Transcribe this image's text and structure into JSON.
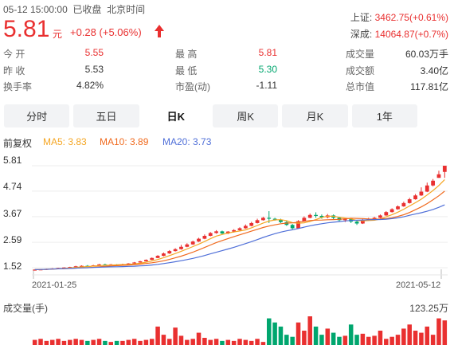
{
  "status": {
    "time": "05-12 15:00:00",
    "state": "已收盘",
    "zone": "北京时间"
  },
  "price": {
    "last": "5.81",
    "unit": "元",
    "change": "+0.28",
    "pct": "(+5.06%)",
    "direction": "up-arrow-icon",
    "color": "#e93030"
  },
  "indices": [
    {
      "name": "上证:",
      "value": "3462.75(+0.61%)"
    },
    {
      "name": "深成:",
      "value": "14064.87(+0.7%)"
    }
  ],
  "quote": {
    "row1": [
      {
        "label": "今  开",
        "value": "5.55",
        "color": "red"
      },
      {
        "label": "最  高",
        "value": "5.81",
        "color": "red"
      },
      {
        "label": "成交量",
        "value": "60.03万手",
        "color": "plain"
      }
    ],
    "row2": [
      {
        "label": "昨  收",
        "value": "5.53",
        "color": "plain"
      },
      {
        "label": "最  低",
        "value": "5.30",
        "color": "green"
      },
      {
        "label": "成交额",
        "value": "3.40亿",
        "color": "plain"
      }
    ],
    "row3": [
      {
        "label": "换手率",
        "value": "4.82%",
        "color": "plain"
      },
      {
        "label": "市盈(动)",
        "value": "-1.11",
        "color": "plain"
      },
      {
        "label": "总市值",
        "value": "117.81亿",
        "color": "plain"
      }
    ]
  },
  "tabs": [
    {
      "label": "分时",
      "active": false
    },
    {
      "label": "五日",
      "active": false
    },
    {
      "label": "日K",
      "active": true
    },
    {
      "label": "周K",
      "active": false
    },
    {
      "label": "月K",
      "active": false
    },
    {
      "label": "1年",
      "active": false
    }
  ],
  "ma_legend": {
    "adjust": "前复权",
    "ma5": "MA5: 3.83",
    "ma10": "MA10: 3.89",
    "ma20": "MA20: 3.73",
    "ma5_color": "#f5a623",
    "ma10_color": "#f06a1e",
    "ma20_color": "#4f6fd8"
  },
  "chart_data": {
    "type": "candlestick",
    "y_ticks": [
      "5.81",
      "4.74",
      "3.67",
      "2.59",
      "1.52"
    ],
    "ylim": [
      1.52,
      5.81
    ],
    "x_start": "2021-01-25",
    "x_end": "2021-05-12",
    "up_color": "#e93030",
    "down_color": "#00a66e",
    "candles": [
      [
        1.42,
        1.44,
        1.4,
        1.45
      ],
      [
        1.43,
        1.45,
        1.42,
        1.46
      ],
      [
        1.44,
        1.47,
        1.43,
        1.48
      ],
      [
        1.46,
        1.49,
        1.45,
        1.5
      ],
      [
        1.48,
        1.51,
        1.47,
        1.52
      ],
      [
        1.5,
        1.53,
        1.49,
        1.54
      ],
      [
        1.52,
        1.55,
        1.51,
        1.56
      ],
      [
        1.54,
        1.58,
        1.53,
        1.6
      ],
      [
        1.57,
        1.6,
        1.55,
        1.62
      ],
      [
        1.6,
        1.58,
        1.56,
        1.63
      ],
      [
        1.58,
        1.62,
        1.57,
        1.64
      ],
      [
        1.62,
        1.66,
        1.6,
        1.68
      ],
      [
        1.66,
        1.64,
        1.62,
        1.69
      ],
      [
        1.63,
        1.66,
        1.62,
        1.68
      ],
      [
        1.65,
        1.64,
        1.62,
        1.67
      ],
      [
        1.64,
        1.67,
        1.63,
        1.69
      ],
      [
        1.66,
        1.7,
        1.65,
        1.71
      ],
      [
        1.7,
        1.74,
        1.69,
        1.76
      ],
      [
        1.74,
        1.79,
        1.73,
        1.81
      ],
      [
        1.79,
        1.85,
        1.78,
        1.87
      ],
      [
        1.85,
        1.93,
        1.84,
        1.95
      ],
      [
        1.93,
        2.02,
        1.92,
        2.05
      ],
      [
        2.02,
        2.12,
        2.0,
        2.16
      ],
      [
        2.12,
        2.22,
        2.1,
        2.26
      ],
      [
        2.22,
        2.3,
        2.2,
        2.34
      ],
      [
        2.3,
        2.4,
        2.28,
        2.48
      ],
      [
        2.4,
        2.5,
        2.38,
        2.55
      ],
      [
        2.5,
        2.62,
        2.48,
        2.66
      ],
      [
        2.62,
        2.74,
        2.6,
        2.78
      ],
      [
        2.74,
        2.86,
        2.72,
        2.92
      ],
      [
        2.86,
        2.98,
        2.84,
        3.02
      ],
      [
        2.98,
        3.05,
        2.95,
        3.1
      ],
      [
        3.05,
        2.96,
        2.92,
        3.08
      ],
      [
        2.96,
        3.04,
        2.93,
        3.06
      ],
      [
        3.04,
        3.1,
        3.0,
        3.14
      ],
      [
        3.1,
        3.18,
        3.08,
        3.22
      ],
      [
        3.18,
        3.28,
        3.16,
        3.34
      ],
      [
        3.28,
        3.4,
        3.26,
        3.45
      ],
      [
        3.4,
        3.52,
        3.38,
        3.58
      ],
      [
        3.52,
        3.62,
        3.5,
        3.66
      ],
      [
        3.62,
        3.58,
        3.4,
        3.9
      ],
      [
        3.58,
        3.54,
        3.5,
        3.62
      ],
      [
        3.54,
        3.44,
        3.4,
        3.58
      ],
      [
        3.44,
        3.32,
        3.28,
        3.48
      ],
      [
        3.32,
        3.18,
        3.14,
        3.36
      ],
      [
        3.18,
        3.48,
        3.16,
        3.52
      ],
      [
        3.48,
        3.62,
        3.46,
        3.68
      ],
      [
        3.62,
        3.74,
        3.6,
        3.8
      ],
      [
        3.74,
        3.7,
        3.62,
        3.85
      ],
      [
        3.7,
        3.64,
        3.58,
        3.76
      ],
      [
        3.64,
        3.72,
        3.6,
        3.78
      ],
      [
        3.72,
        3.62,
        3.56,
        3.76
      ],
      [
        3.62,
        3.52,
        3.48,
        3.66
      ],
      [
        3.52,
        3.56,
        3.44,
        3.6
      ],
      [
        3.56,
        3.46,
        3.4,
        3.6
      ],
      [
        3.46,
        3.38,
        3.32,
        3.5
      ],
      [
        3.38,
        3.54,
        3.36,
        3.58
      ],
      [
        3.54,
        3.58,
        3.5,
        3.62
      ],
      [
        3.58,
        3.62,
        3.54,
        3.66
      ],
      [
        3.62,
        3.72,
        3.6,
        3.76
      ],
      [
        3.72,
        3.86,
        3.7,
        3.9
      ],
      [
        3.86,
        3.98,
        3.84,
        4.02
      ],
      [
        3.98,
        4.1,
        3.96,
        4.14
      ],
      [
        4.1,
        4.24,
        4.08,
        4.3
      ],
      [
        4.24,
        4.4,
        4.22,
        4.46
      ],
      [
        4.4,
        4.56,
        4.38,
        4.62
      ],
      [
        4.56,
        4.72,
        4.54,
        4.9
      ],
      [
        4.72,
        4.98,
        4.7,
        5.1
      ],
      [
        4.98,
        5.18,
        4.94,
        5.25
      ],
      [
        5.3,
        5.45,
        5.3,
        5.6
      ],
      [
        5.55,
        5.81,
        5.3,
        5.81
      ]
    ],
    "volumes": [
      5,
      6,
      4,
      5,
      6,
      4,
      5,
      6,
      5,
      4,
      5,
      6,
      4,
      3,
      4,
      4,
      5,
      6,
      4,
      5,
      6,
      18,
      10,
      6,
      17,
      9,
      5,
      6,
      12,
      7,
      5,
      6,
      4,
      5,
      4,
      6,
      5,
      4,
      6,
      3,
      26,
      22,
      18,
      10,
      8,
      22,
      14,
      28,
      18,
      10,
      16,
      12,
      8,
      9,
      20,
      10,
      11,
      8,
      9,
      14,
      6,
      8,
      10,
      16,
      20,
      14,
      12,
      18,
      10,
      26,
      24
    ],
    "volume_label": "成交量(手)",
    "volume_max_label": "123.25万"
  }
}
